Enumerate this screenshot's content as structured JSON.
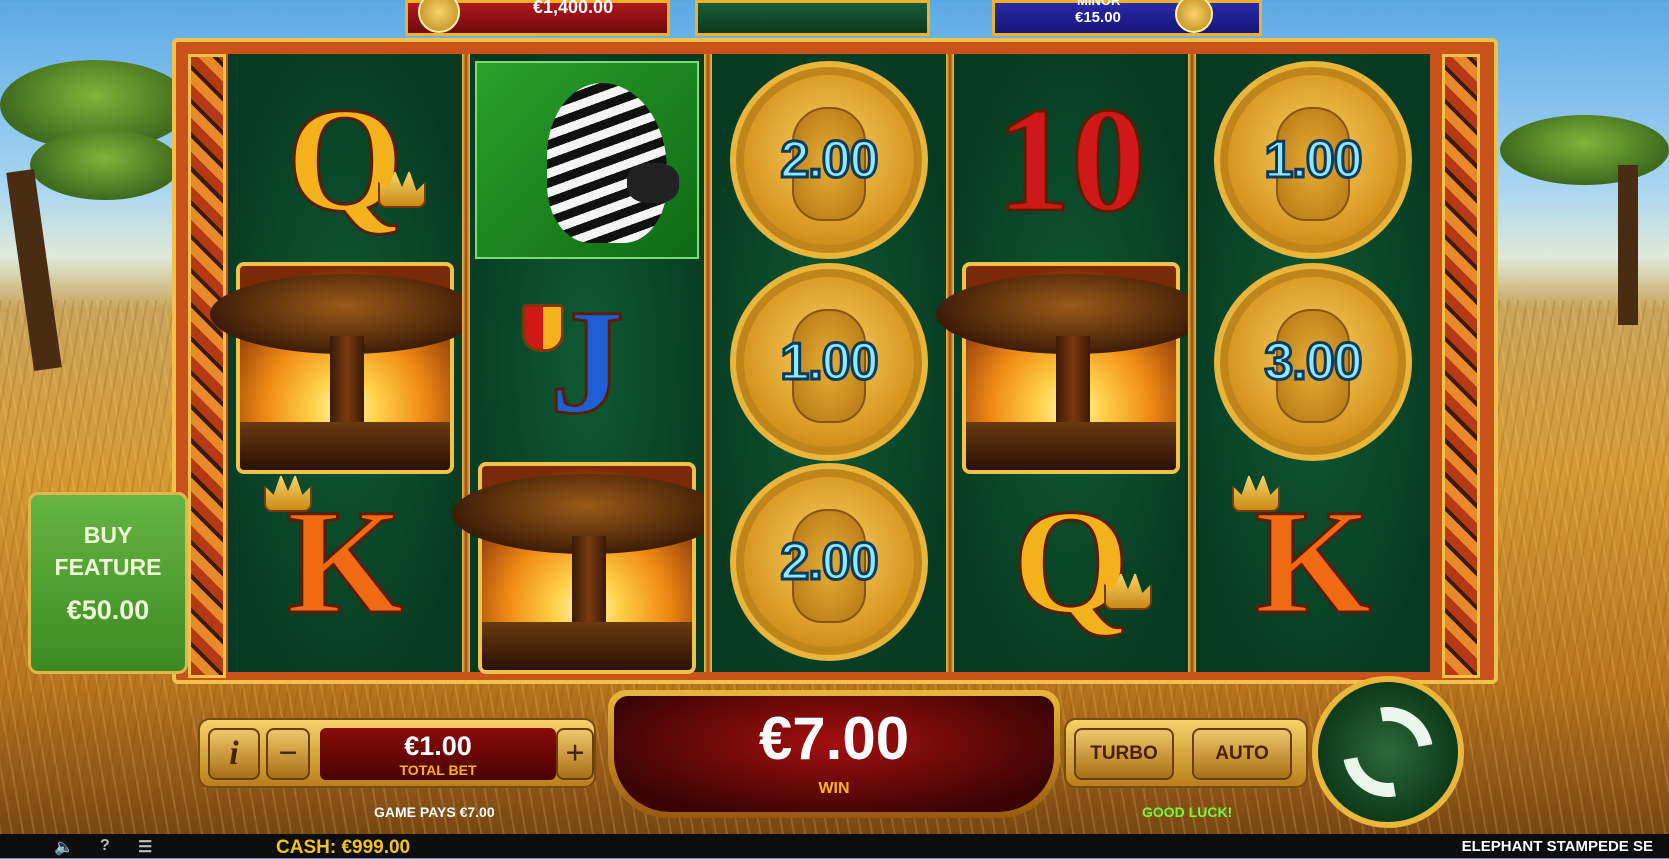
{
  "top_banners": {
    "left_value": "€1,400.00",
    "right_label": "MINOR",
    "right_value": "€15.00"
  },
  "reels": [
    [
      {
        "type": "letter",
        "text": "Q",
        "color": "#f3b21c",
        "crown": true
      },
      {
        "type": "tree"
      },
      {
        "type": "letter",
        "text": "K",
        "color": "#f06a14",
        "crown": true
      }
    ],
    [
      {
        "type": "zebra"
      },
      {
        "type": "letter",
        "text": "J",
        "color": "#1f5fd6",
        "shield": true
      },
      {
        "type": "tree"
      }
    ],
    [
      {
        "type": "coin",
        "text": "2.00"
      },
      {
        "type": "coin",
        "text": "1.00"
      },
      {
        "type": "coin",
        "text": "2.00"
      }
    ],
    [
      {
        "type": "letter",
        "text": "10",
        "color": "#d11818"
      },
      {
        "type": "tree"
      },
      {
        "type": "letter",
        "text": "Q",
        "color": "#f3b21c",
        "crown": true
      }
    ],
    [
      {
        "type": "coin",
        "text": "1.00"
      },
      {
        "type": "coin",
        "text": "3.00"
      },
      {
        "type": "letter",
        "text": "K",
        "color": "#f06a14",
        "crown": true
      }
    ]
  ],
  "buy_feature": {
    "line1": "BUY",
    "line2": "FEATURE",
    "price": "€50.00"
  },
  "bet": {
    "info_label": "i",
    "minus_label": "−",
    "plus_label": "+",
    "value": "€1.00",
    "label": "TOTAL BET",
    "game_pays": "GAME PAYS €7.00"
  },
  "win": {
    "amount": "€7.00",
    "label": "WIN"
  },
  "controls": {
    "turbo": "TURBO",
    "auto": "AUTO",
    "message": "GOOD LUCK!"
  },
  "status": {
    "cash": "CASH:  €999.00",
    "game_name": "ELEPHANT STAMPEDE SE",
    "sound_icon": "🔈",
    "help_icon": "?",
    "menu_icon": "☰"
  },
  "colors": {
    "reel_bg": "#073a22",
    "frame": "#c9531a",
    "gold": "#f0c24a",
    "win_red": "#a40f0f"
  }
}
